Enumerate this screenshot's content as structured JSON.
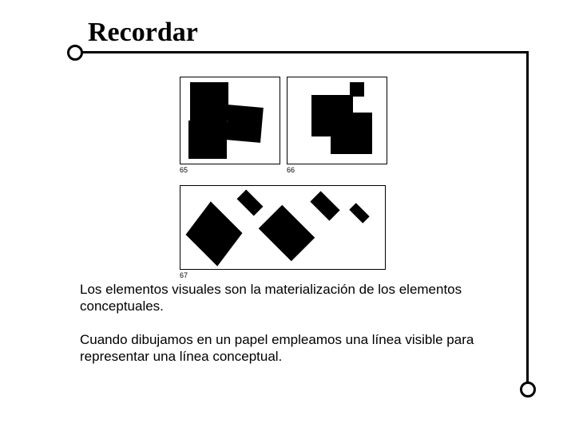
{
  "title": "Recordar",
  "figures": {
    "fig65_label": "65",
    "fig66_label": "66",
    "fig67_label": "67"
  },
  "paragraph1": "Los elementos visuales son la materialización de los elementos conceptuales.",
  "paragraph2": "Cuando dibujamos en un papel empleamos una línea visible para representar una línea conceptual."
}
